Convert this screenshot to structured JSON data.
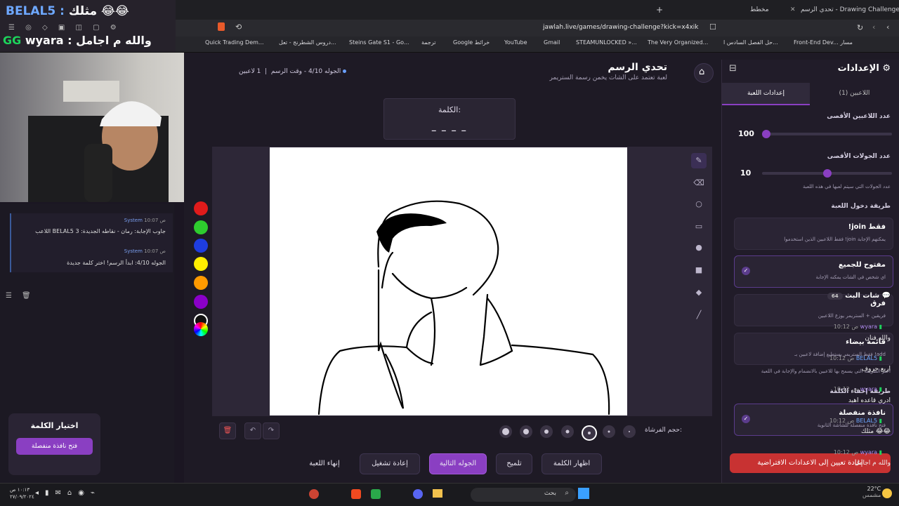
{
  "browser": {
    "tabs": [
      "تحدي الرسم - Drawing Challenge",
      "مخطط"
    ],
    "url": "jawlah.live/games/drawing-challenge?kick=x4xik",
    "bookmarks": [
      "Quick Trading Dem...",
      "دروس الشطرنج - تعل...",
      "Steins Gate S1 - Go...",
      "ترجمة",
      "Google خرائط",
      "YouTube",
      "Gmail",
      "STEAMUNLOCKED »...",
      "The Very Organized...",
      "حل الفصل السادس ا...",
      "Front-End Dev... مسار"
    ]
  },
  "stream_overlay": {
    "line1_name": "BELAL5 :",
    "line1_text": "مثلك 😂😂",
    "line2_badge": "GG",
    "line2_name": "wyara :",
    "line2_text": "والله م اجامل"
  },
  "header": {
    "title": "تحدي الرسم",
    "subtitle": "لعبة تعتمد على الشات يخمن رسمة الستريمر",
    "round_info": "الجوله 4/10 - وقت الرسم",
    "players": "1 لاعبين"
  },
  "word_box": {
    "label": "الكلمة:",
    "blanks": "_ _ _ _"
  },
  "brush": {
    "label": "حجم الفرشاة:"
  },
  "palette": [
    "#e01b1b",
    "#2ecc2e",
    "#1e3de0",
    "#ffee00",
    "#ff9a00",
    "#8a00c8"
  ],
  "actions": {
    "end_game": "إنهاء اللعبة",
    "restart": "إعادة تشغيل",
    "next_round": "الجوله التالية",
    "hint": "تلميح",
    "show_word": "اظهار الكلمة"
  },
  "settings": {
    "title": "الإعدادات",
    "tabs": {
      "game_settings": "إعدادات اللعبة",
      "players": "اللاعبين (1)"
    },
    "max_players_label": "عدد اللاعبين الأقصى",
    "max_players_value": "100",
    "max_players_level": 0,
    "max_rounds_label": "عدد الجولات الأقصى",
    "max_rounds_value": "10",
    "max_rounds_level": 0.5,
    "max_rounds_desc": "عدد الجولات التي سيتم لعبها في هذه اللعبة",
    "join_method_label": "طريقة دخول اللعبة",
    "join_options": [
      {
        "title": "!join فقط",
        "desc": "فقط اللاعبين الذين استخدموا !join يمكنهم الإجابة",
        "selected": false
      },
      {
        "title": "مفتوح للجميع",
        "desc": "اي شخص في الشات يمكنه الإجابة",
        "selected": true
      },
      {
        "title": "فرق",
        "desc": "فريقين + الستريمر يوزع اللاعبين",
        "selected": false
      },
      {
        "title": "قائمة بيضاء",
        "desc": "فقط الستريمر يستطيع إضافة لاعبين بـ !add",
        "selected": false
      }
    ],
    "join_note": "اختر الطريقة التي يسمح بها للاعبين بالانضمام والإجابة في اللعبة",
    "hide_word_label": "طريقة إخفاء الكلمة",
    "hide_option": {
      "title": "نافذة منفصلة",
      "desc": "فتح نافذة منفصلة للشاشة الثانوية"
    },
    "reset_button": "إعادة تعيين إلى الاعدادات الافتراضية"
  },
  "system_log": [
    {
      "time": "10:07 ص",
      "sender": "System",
      "text": "اللاعب BELAL5 جاوب الإجابة: رمان - نقاطه الجديدة: 3"
    },
    {
      "time": "10:07 ص",
      "sender": "System",
      "text": "الجوله 4/10: ابدأ الرسم! اختر كلمة جديدة"
    }
  ],
  "stream_chat": {
    "title": "شات البث",
    "count": "64",
    "messages": [
      {
        "time": "10:12 ص",
        "user": "wyara",
        "text": "والله فنان"
      },
      {
        "time": "10:12 ص",
        "user": "BELAL5",
        "text": "اربع حروف"
      },
      {
        "time": "10:12 ص",
        "user": "wyara",
        "text": "ادري قاعده اهبد"
      },
      {
        "time": "10:12 ص",
        "user": "BELAL5",
        "text": "مثلك 😂😂"
      },
      {
        "time": "10:12 ص",
        "user": "wyara",
        "text": "والله م اجامل"
      }
    ]
  },
  "choose_word": {
    "title": "اختيار الكلمة",
    "button": "فتح نافذة منفصلة"
  },
  "taskbar": {
    "search": "بحث",
    "weather": "22°C",
    "weather_desc": "مشمس",
    "time": "١٠:١٣ ص",
    "date": "٢٧/٠٩/٢٠٢٤"
  }
}
